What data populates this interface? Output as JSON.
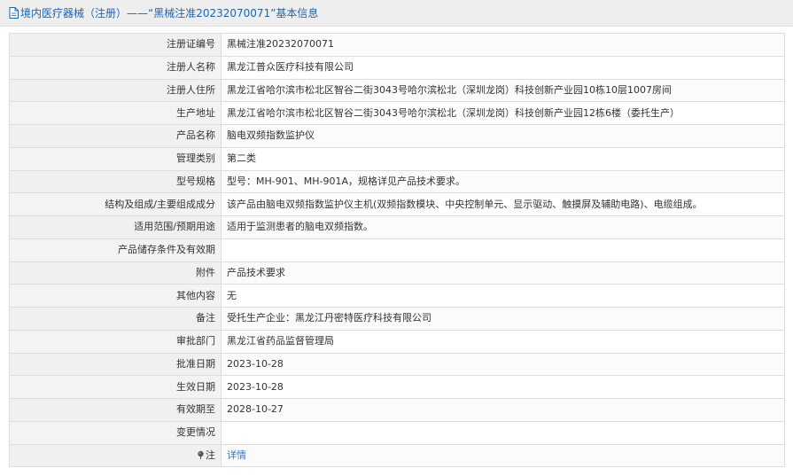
{
  "header": {
    "title": "境内医疗器械（注册）——“黑械注准20232070071”基本信息",
    "icon": "document-icon",
    "color": "#1a66b3"
  },
  "rows": [
    {
      "label": "注册证编号",
      "value": "黑械注准20232070071"
    },
    {
      "label": "注册人名称",
      "value": "黑龙江普众医疗科技有限公司"
    },
    {
      "label": "注册人住所",
      "value": "黑龙江省哈尔滨市松北区智谷二街3043号哈尔滨松北（深圳龙岗）科技创新产业园10栋10层1007房间"
    },
    {
      "label": "生产地址",
      "value": "黑龙江省哈尔滨市松北区智谷二街3043号哈尔滨松北（深圳龙岗）科技创新产业园12栋6楼（委托生产）"
    },
    {
      "label": "产品名称",
      "value": "脑电双频指数监护仪"
    },
    {
      "label": "管理类别",
      "value": "第二类"
    },
    {
      "label": "型号规格",
      "value": "型号：MH-901、MH-901A，规格详见产品技术要求。"
    },
    {
      "label": "结构及组成/主要组成成分",
      "value": "该产品由脑电双频指数监护仪主机(双频指数模块、中央控制单元、显示驱动、触摸屏及辅助电路)、电缆组成。"
    },
    {
      "label": "适用范围/预期用途",
      "value": "适用于监测患者的脑电双频指数。"
    },
    {
      "label": "产品储存条件及有效期",
      "value": ""
    },
    {
      "label": "附件",
      "value": "产品技术要求"
    },
    {
      "label": "其他内容",
      "value": "无"
    },
    {
      "label": "备注",
      "value": "受托生产企业：黑龙江丹密特医疗科技有限公司"
    },
    {
      "label": "审批部门",
      "value": "黑龙江省药品监督管理局"
    },
    {
      "label": "批准日期",
      "value": "2023-10-28"
    },
    {
      "label": "生效日期",
      "value": "2023-10-28"
    },
    {
      "label": "有效期至",
      "value": "2028-10-27"
    },
    {
      "label": "变更情况",
      "value": ""
    }
  ],
  "note_row": {
    "label": "注",
    "icon": "pin-icon",
    "link_text": "详情",
    "link_color": "#2f78c4"
  }
}
